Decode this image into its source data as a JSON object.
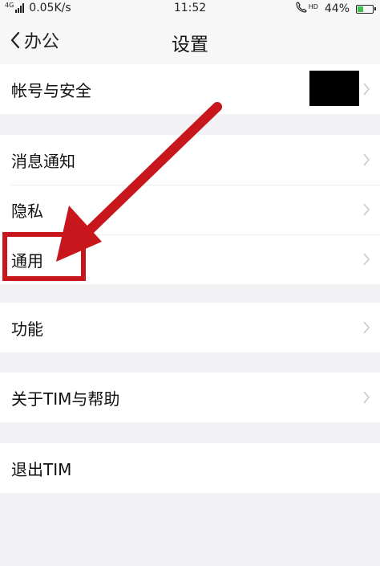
{
  "status_bar": {
    "network_type": "4G",
    "network_speed": "0.05K/s",
    "time": "11:52",
    "hd_label": "HD",
    "battery_percent": "44%",
    "battery_level": 0.44,
    "battery_color": "#3cc14a"
  },
  "nav": {
    "back_label": "办公",
    "title": "设置"
  },
  "groups": [
    {
      "items": [
        {
          "label": "帐号与安全"
        }
      ]
    },
    {
      "items": [
        {
          "label": "消息通知"
        },
        {
          "label": "隐私"
        },
        {
          "label": "通用"
        }
      ]
    },
    {
      "items": [
        {
          "label": "功能"
        }
      ]
    },
    {
      "items": [
        {
          "label": "关于TIM与帮助"
        }
      ]
    },
    {
      "items": [
        {
          "label": "退出TIM"
        }
      ]
    }
  ],
  "annotation_color": "#c8161d"
}
